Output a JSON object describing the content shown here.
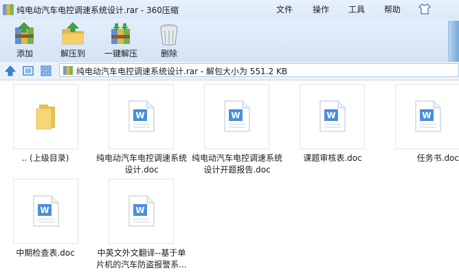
{
  "window": {
    "title": "纯电动汽车电控调速系统设计.rar - 360压缩",
    "menus": [
      "文件",
      "操作",
      "工具",
      "帮助"
    ]
  },
  "toolbar": {
    "add": "添加",
    "extract_to": "解压到",
    "one_click_extract": "一键解压",
    "delete": "删除"
  },
  "address": {
    "path": "纯电动汽车电控调速系统设计.rar - 解包大小为 551.2 KB"
  },
  "files": [
    {
      "name": ".. (上级目录)",
      "type": "folder"
    },
    {
      "name": "纯电动汽车电控调速系统设计.doc",
      "type": "doc"
    },
    {
      "name": "纯电动汽车电控调速系统设计开题报告.doc",
      "type": "doc"
    },
    {
      "name": "课题审核表.doc",
      "type": "doc"
    },
    {
      "name": "任务书.doc",
      "type": "doc"
    },
    {
      "name": "中期检查表.doc",
      "type": "doc"
    },
    {
      "name": "中英文外文翻译--基于单片机的汽车防盗报警系...",
      "type": "doc"
    }
  ]
}
